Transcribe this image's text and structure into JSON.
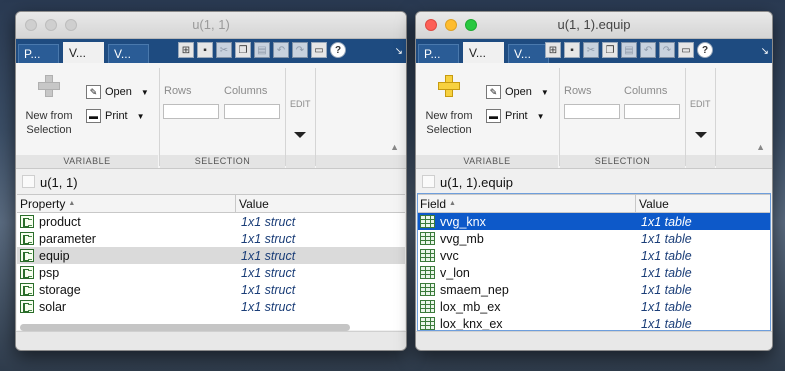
{
  "left_window": {
    "title": "u(1, 1)",
    "tabs": [
      "P...",
      "V...",
      "V..."
    ],
    "ribbon": {
      "new_from_selection_line1": "New from",
      "new_from_selection_line2": "Selection",
      "open_label": "Open",
      "print_label": "Print",
      "rows_label": "Rows",
      "columns_label": "Columns",
      "edit_label": "EDIT",
      "group_variable": "VARIABLE",
      "group_selection": "SELECTION"
    },
    "address": "u(1, 1)",
    "table": {
      "col1": "Property",
      "col2": "Value",
      "rows": [
        {
          "name": "product",
          "value": "1x1 struct"
        },
        {
          "name": "parameter",
          "value": "1x1 struct"
        },
        {
          "name": "equip",
          "value": "1x1 struct"
        },
        {
          "name": "psp",
          "value": "1x1 struct"
        },
        {
          "name": "storage",
          "value": "1x1 struct"
        },
        {
          "name": "solar",
          "value": "1x1 struct"
        }
      ]
    }
  },
  "right_window": {
    "title": "u(1, 1).equip",
    "tabs": [
      "P...",
      "V...",
      "V..."
    ],
    "ribbon": {
      "new_from_selection_line1": "New from",
      "new_from_selection_line2": "Selection",
      "open_label": "Open",
      "print_label": "Print",
      "rows_label": "Rows",
      "columns_label": "Columns",
      "edit_label": "EDIT",
      "group_variable": "VARIABLE",
      "group_selection": "SELECTION"
    },
    "address": "u(1, 1).equip",
    "table": {
      "col1": "Field",
      "col2": "Value",
      "rows": [
        {
          "name": "vvg_knx",
          "value": "1x1 table"
        },
        {
          "name": "vvg_mb",
          "value": "1x1 table"
        },
        {
          "name": "vvc",
          "value": "1x1 table"
        },
        {
          "name": "v_lon",
          "value": "1x1 table"
        },
        {
          "name": "smaem_nep",
          "value": "1x1 table"
        },
        {
          "name": "lox_mb_ex",
          "value": "1x1 table"
        },
        {
          "name": "lox_knx_ex",
          "value": "1x1 table"
        }
      ]
    }
  },
  "icons": [
    "new-from-selection-icon",
    "open-icon",
    "print-icon",
    "struct-icon",
    "table-icon",
    "help-icon",
    "save-icon",
    "cut-icon",
    "copy-icon",
    "paste-icon",
    "undo-icon",
    "redo-icon",
    "switch-windows-icon"
  ]
}
